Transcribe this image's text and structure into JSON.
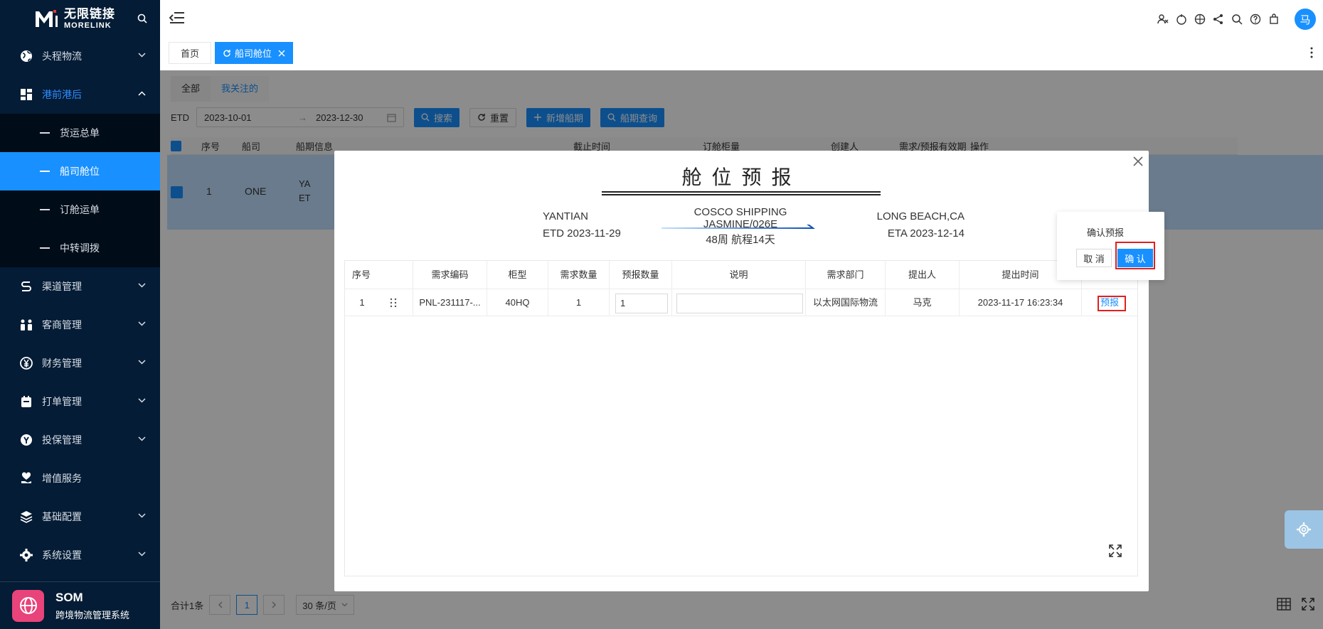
{
  "brand": {
    "name_cn": "无限链接",
    "name_en": "MORELINK",
    "system_short": "SOM",
    "system_name": "跨境物流管理系统"
  },
  "sidebar": {
    "items": [
      {
        "label": "头程物流",
        "icon": "globe-icon"
      },
      {
        "label": "港前港后",
        "icon": "dashboard-icon"
      },
      {
        "label": "渠道管理",
        "icon": "route-icon"
      },
      {
        "label": "客商管理",
        "icon": "customer-icon"
      },
      {
        "label": "财务管理",
        "icon": "yen-icon"
      },
      {
        "label": "打单管理",
        "icon": "print-icon"
      },
      {
        "label": "投保管理",
        "icon": "insurance-icon"
      },
      {
        "label": "增值服务",
        "icon": "heart-hand-icon"
      },
      {
        "label": "基础配置",
        "icon": "layers-icon"
      },
      {
        "label": "系统设置",
        "icon": "gear-icon"
      }
    ],
    "subitems": [
      "货运总单",
      "船司舱位",
      "订舱运单",
      "中转调拨"
    ]
  },
  "header": {
    "avatar": "马"
  },
  "page_tabs": {
    "home": "首页",
    "current": "船司舱位"
  },
  "content": {
    "sub_tabs": [
      "全部",
      "我关注的"
    ],
    "filter": {
      "label": "ETD",
      "start": "2023-10-01",
      "end": "2023-12-30",
      "search": "搜索",
      "reset": "重置",
      "add": "新增船期",
      "query": "船期查询"
    },
    "table_headers": [
      "序号",
      "船司",
      "船期信息",
      "截止时间",
      "订舱柜量",
      "创建人",
      "需求/预报有效期",
      "操作"
    ],
    "row": {
      "index": "1",
      "carrier": "ONE",
      "info1": "YA",
      "info2": "ET"
    },
    "pager": {
      "total": "合计1条",
      "page": "1",
      "size": "30 条/页"
    }
  },
  "modal": {
    "title": "舱位预报",
    "pol": "YANTIAN",
    "etd": "ETD 2023-11-29",
    "vessel": "COSCO SHIPPING JASMINE/026E",
    "voyage": "48周 航程14天",
    "pod": "LONG BEACH,CA",
    "eta": "ETA 2023-12-14",
    "table": {
      "headers": [
        "序号",
        "需求编码",
        "柜型",
        "需求数量",
        "预报数量",
        "说明",
        "需求部门",
        "提出人",
        "提出时间"
      ],
      "row": {
        "index": "1",
        "code": "PNL-231117-...",
        "container": "40HQ",
        "qty": "1",
        "forecast": "1",
        "desc": "",
        "dept": "以太网国际物流",
        "proposer": "马克",
        "time": "2023-11-17 16:23:34",
        "action": "预报"
      }
    }
  },
  "popconfirm": {
    "message": "确认预报",
    "cancel": "取 消",
    "ok": "确 认"
  },
  "colors": {
    "primary": "#1890ff",
    "sidebar_bg": "#041c35",
    "highlight": "#e02020"
  }
}
